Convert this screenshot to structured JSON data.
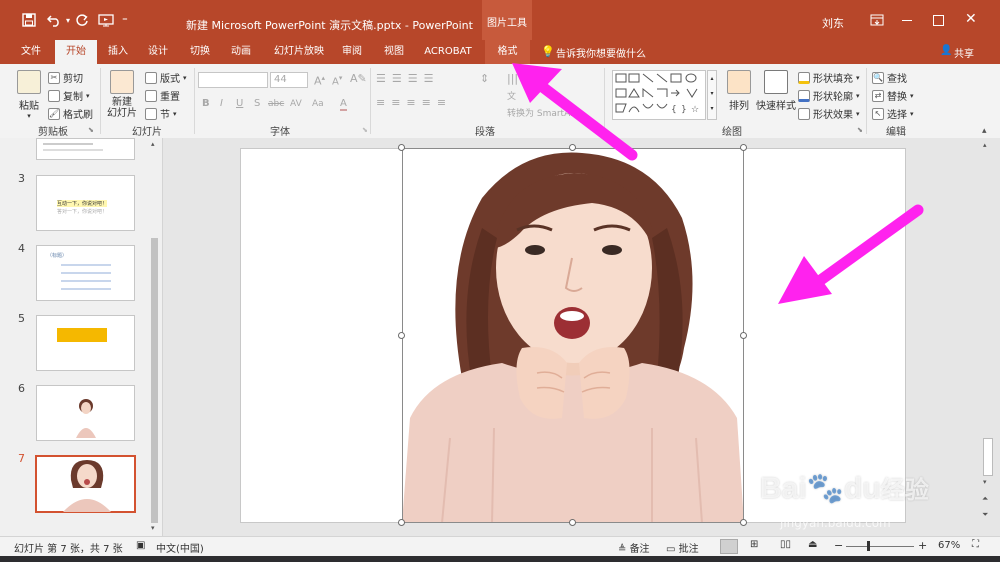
{
  "titlebar": {
    "doc_title": "新建 Microsoft PowerPoint 演示文稿.pptx  -  PowerPoint",
    "context_tools": "图片工具",
    "user": "刘东",
    "quick_access": {
      "customize": "⁼"
    }
  },
  "ribbon_tabs": [
    {
      "label": "文件"
    },
    {
      "label": "开始"
    },
    {
      "label": "插入"
    },
    {
      "label": "设计"
    },
    {
      "label": "切换"
    },
    {
      "label": "动画"
    },
    {
      "label": "幻灯片放映"
    },
    {
      "label": "审阅"
    },
    {
      "label": "视图"
    },
    {
      "label": "ACROBAT"
    },
    {
      "label": "格式"
    }
  ],
  "tell_me": "告诉我你想要做什么",
  "share": "共享",
  "ribbon": {
    "clipboard": {
      "paste": "粘贴",
      "cut": "剪切",
      "copy": "复制",
      "format_painter": "格式刷",
      "label": "剪贴板"
    },
    "slides": {
      "new_slide_line1": "新建",
      "new_slide_line2": "幻灯片",
      "layout": "版式",
      "reset": "重置",
      "section": "节",
      "label": "幻灯片"
    },
    "font": {
      "name": "",
      "size": "44",
      "label": "字体",
      "bold": "B",
      "italic": "I",
      "underline": "U",
      "shadow": "S",
      "strike": "abc",
      "spacing": "AV",
      "case": "Aa",
      "color": "A"
    },
    "paragraph": {
      "text_dir": "文",
      "smartart": "转换为 SmartArt",
      "label": "段落"
    },
    "drawing": {
      "arrange": "排列",
      "quick_styles": "快速样式",
      "fill": "形状填充",
      "outline": "形状轮廓",
      "effects": "形状效果",
      "label": "绘图"
    },
    "editing": {
      "find": "查找",
      "replace": "替换",
      "select": "选择",
      "label": "编辑"
    }
  },
  "thumbnails": [
    {
      "num": "",
      "line1": "",
      "line2": ""
    },
    {
      "num": "3",
      "line1": "互动一下，你说对吧！",
      "line2": "答对一下，你说对吧！"
    },
    {
      "num": "4",
      "line1": "（标题）",
      "line2": ""
    },
    {
      "num": "5",
      "line1": "",
      "line2": ""
    },
    {
      "num": "6",
      "line1": "",
      "line2": ""
    },
    {
      "num": "7",
      "line1": "",
      "line2": ""
    }
  ],
  "statusbar": {
    "slide_info": "幻灯片 第 7 张，共 7 张",
    "language": "中文(中国)",
    "notes": "备注",
    "comments": "批注",
    "zoom": "67%"
  },
  "watermark": {
    "brand": "Bai",
    "brand2": "du",
    "cn": "经验",
    "url": "jingyan.baidu.com"
  },
  "colors": {
    "accent": "#b7472a",
    "arrow": "#ff22ee"
  }
}
